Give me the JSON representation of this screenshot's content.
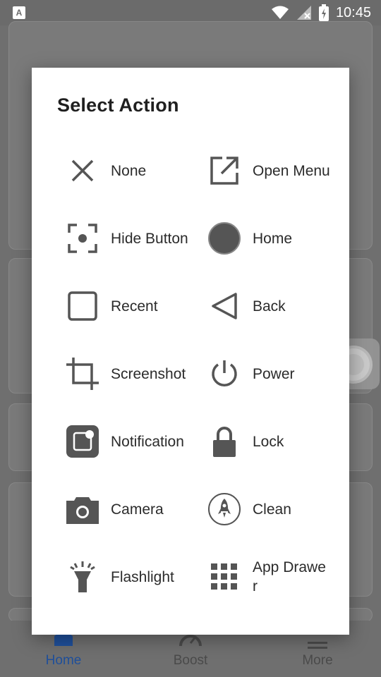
{
  "status_bar": {
    "time": "10:45",
    "left_badge": "A"
  },
  "background": {
    "bottom_nav": [
      {
        "label": "Home",
        "icon": "home-icon"
      },
      {
        "label": "Boost",
        "icon": "speedometer-icon"
      },
      {
        "label": "More",
        "icon": "menu-icon"
      }
    ]
  },
  "dialog": {
    "title": "Select Action",
    "actions": [
      {
        "label": "None",
        "icon": "close-icon"
      },
      {
        "label": "Open Menu",
        "icon": "open-in-new-icon"
      },
      {
        "label": "Hide Button",
        "icon": "focus-icon"
      },
      {
        "label": "Home",
        "icon": "home-circle-icon"
      },
      {
        "label": "Recent",
        "icon": "recent-square-icon"
      },
      {
        "label": "Back",
        "icon": "back-triangle-icon"
      },
      {
        "label": "Screenshot",
        "icon": "crop-icon"
      },
      {
        "label": "Power",
        "icon": "power-icon"
      },
      {
        "label": "Notification",
        "icon": "notification-icon"
      },
      {
        "label": "Lock",
        "icon": "lock-icon"
      },
      {
        "label": "Camera",
        "icon": "camera-icon"
      },
      {
        "label": "Clean",
        "icon": "rocket-icon"
      },
      {
        "label": "Flashlight",
        "icon": "flashlight-icon"
      },
      {
        "label": "App Drawer",
        "icon": "app-grid-icon"
      }
    ]
  },
  "colors": {
    "nav_active": "#1f4f9a",
    "icon": "#555555",
    "dialog_bg": "#ffffff",
    "scrim": "#6f6f6f"
  }
}
